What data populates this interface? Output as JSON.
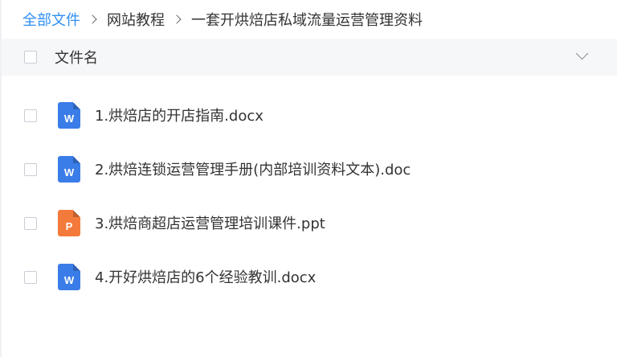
{
  "breadcrumb": {
    "root": "全部文件",
    "level1": "网站教程",
    "current": "一套开烘焙店私域流量运营管理资料"
  },
  "header": {
    "name_label": "文件名"
  },
  "files": [
    {
      "name": "1.烘焙店的开店指南.docx",
      "type": "word",
      "icon_letter": "W"
    },
    {
      "name": "2.烘焙连锁运营管理手册(内部培训资料文本).doc",
      "type": "word",
      "icon_letter": "W"
    },
    {
      "name": "3.烘焙商超店运营管理培训课件.ppt",
      "type": "ppt",
      "icon_letter": "P"
    },
    {
      "name": "4.开好烘焙店的6个经验教训.docx",
      "type": "word",
      "icon_letter": "W"
    }
  ],
  "colors": {
    "link": "#2f8ff3",
    "word_icon": "#3b7de8",
    "ppt_icon": "#f47a3b",
    "header_bg": "#f6f7f9"
  }
}
